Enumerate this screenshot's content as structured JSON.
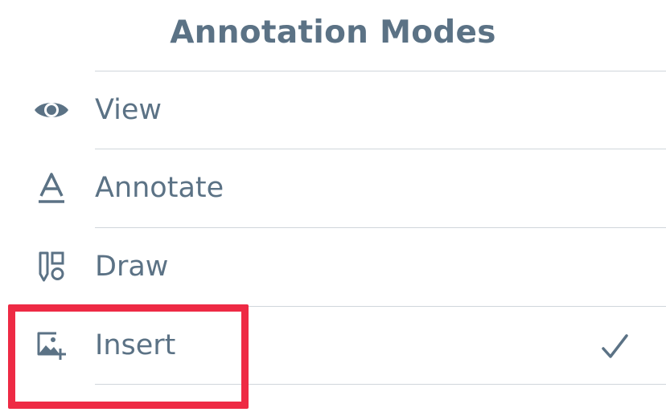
{
  "menu": {
    "title": "Annotation Modes",
    "items": [
      {
        "label": "View",
        "icon": "eye-icon",
        "selected": false
      },
      {
        "label": "Annotate",
        "icon": "text-underline-a-icon",
        "selected": false
      },
      {
        "label": "Draw",
        "icon": "draw-tools-icon",
        "selected": false
      },
      {
        "label": "Insert",
        "icon": "image-add-icon",
        "selected": true
      }
    ],
    "selected_indicator_icon": "checkmark-icon"
  },
  "colors": {
    "text": "#5b7285",
    "divider": "#d0d6db",
    "highlight_box": "#ee2a44",
    "background": "#ffffff"
  }
}
